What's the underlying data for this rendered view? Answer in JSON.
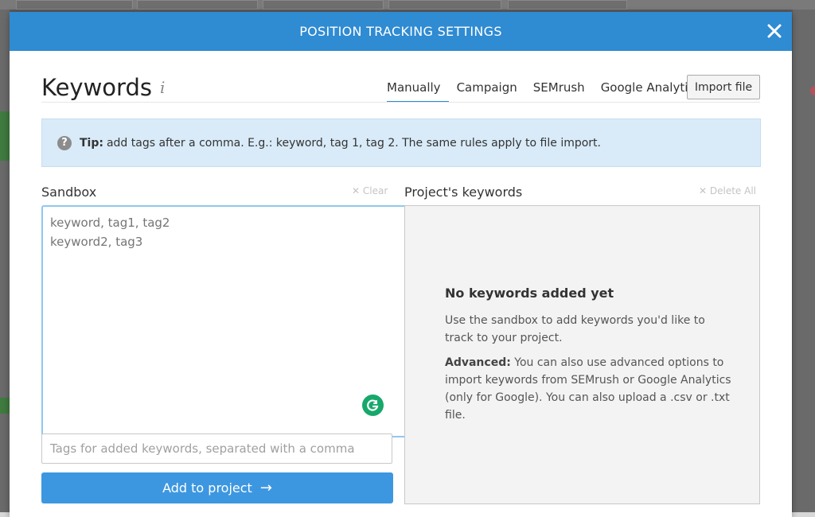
{
  "modal": {
    "title": "POSITION TRACKING SETTINGS"
  },
  "keywords": {
    "heading": "Keywords",
    "info_icon": "i",
    "tabs": [
      {
        "label": "Manually",
        "active": true
      },
      {
        "label": "Campaign",
        "active": false
      },
      {
        "label": "SEMrush",
        "active": false
      },
      {
        "label": "Google Analytics",
        "active": false
      }
    ],
    "import_label": "Import file"
  },
  "tip": {
    "icon": "?",
    "bold": "Tip:",
    "text": "add tags after a comma. E.g.: keyword, tag 1, tag 2. The same rules apply to file import."
  },
  "sandbox": {
    "label": "Sandbox",
    "clear_label": "Clear",
    "placeholder": "keyword, tag1, tag2\nkeyword2, tag3",
    "tags_placeholder": "Tags for added keywords, separated with a comma",
    "add_label": "Add to project"
  },
  "project": {
    "label": "Project's keywords",
    "delete_all_label": "Delete All",
    "empty_title": "No keywords added yet",
    "empty_text": "Use the sandbox to add keywords you'd like to track to your project.",
    "advanced_bold": "Advanced:",
    "advanced_text": "You can also use advanced options to import keywords from SEMrush or Google Analytics (only for Google). You can also upload a .csv or .txt file."
  },
  "colors": {
    "header_blue": "#2f8bd2",
    "button_blue": "#3d97e0",
    "tip_bg": "#d9ebf8",
    "grammarly_green": "#17a86b"
  }
}
